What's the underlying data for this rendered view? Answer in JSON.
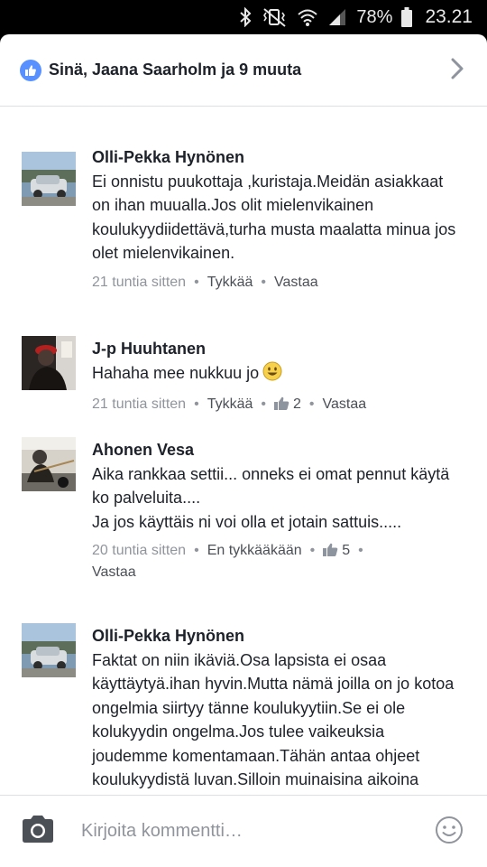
{
  "status_bar": {
    "battery": "78%",
    "time": "23.21",
    "icons": [
      "bluetooth-icon",
      "vibrate-mute-icon",
      "wifi-icon",
      "signal-icon",
      "battery-icon"
    ]
  },
  "header": {
    "reactions_text": "Sinä, Jaana Saarholm ja 9 muuta",
    "icon": "like-icon",
    "chevron": "chevron-right-icon"
  },
  "comments": [
    {
      "name": "Olli-Pekka Hynönen",
      "text": "Ei onnistu puukottaja ,kuristaja.Meidän asiakkaat on ihan muualla.Jos olit mielenvikainen  koulukyydiidettävä,turha musta maalatta minua jos olet mielenvikainen.",
      "time": "21 tuntia sitten",
      "like_label": "Tykkää",
      "reply_label": "Vastaa"
    },
    {
      "name": "J-p Huuhtanen",
      "text": "Hahaha mee nukkuu jo",
      "time": "21 tuntia sitten",
      "like_label": "Tykkää",
      "like_count": "2",
      "reply_label": "Vastaa"
    },
    {
      "name": "Ahonen Vesa",
      "text": "Aika rankkaa settii... onneks ei omat pennut käytä ko palveluita....\nJa jos käyttäis ni voi olla et jotain sattuis.....",
      "time": "20 tuntia sitten",
      "like_label": "En tykkääkään",
      "like_count": "5",
      "reply_label": "Vastaa"
    },
    {
      "name": "Olli-Pekka Hynönen",
      "text": "Faktat on niin ikäviä.Osa lapsista ei osaa käyttäytyä.ihan hyvin.Mutta nämä joilla on jo kotoa ongelmia siirtyy tänne koulukyytiin.Se ei ole kolukyydin ongelma.Jos tulee vaikeuksia joudemme komentamaan.Tähän antaa ohjeet koulukyydistä luvan.Silloin muinaisina aikoina vanhemmista ei kukaan epäillyt"
    }
  ],
  "composer": {
    "placeholder": "Kirjoita kommentti…",
    "camera_icon": "camera-icon",
    "emoji_icon": "emoji-icon"
  }
}
